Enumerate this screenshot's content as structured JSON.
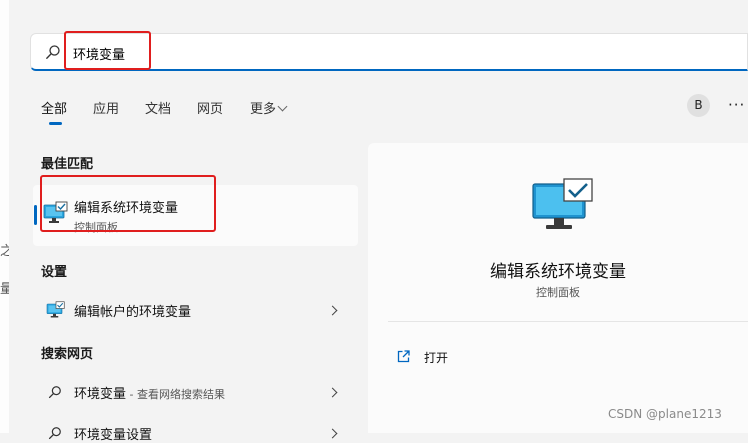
{
  "search": {
    "query": "环境变量"
  },
  "tabs": [
    {
      "label": "全部",
      "active": true
    },
    {
      "label": "应用"
    },
    {
      "label": "文档"
    },
    {
      "label": "网页"
    },
    {
      "label": "更多"
    }
  ],
  "account": {
    "initial": "B"
  },
  "more_options": "···",
  "sections": {
    "best_match": "最佳匹配",
    "settings": "设置",
    "web_search": "搜索网页"
  },
  "best_match": {
    "title": "编辑系统环境变量",
    "subtitle": "控制面板"
  },
  "settings_items": [
    {
      "label": "编辑帐户的环境变量"
    }
  ],
  "web_items": [
    {
      "label": "环境变量",
      "suffix": " - 查看网络搜索结果"
    },
    {
      "label": "环境变量设置"
    }
  ],
  "detail": {
    "title": "编辑系统环境变量",
    "subtitle": "控制面板",
    "action_open": "打开"
  },
  "background_glyphs": [
    "之",
    "量"
  ],
  "watermark": "CSDN @plane1213",
  "colors": {
    "accent": "#0067c0",
    "highlight": "#e01e1e"
  },
  "icons": {
    "control_panel": "monitor-check-icon",
    "search": "search-icon",
    "open": "open-external-icon"
  }
}
